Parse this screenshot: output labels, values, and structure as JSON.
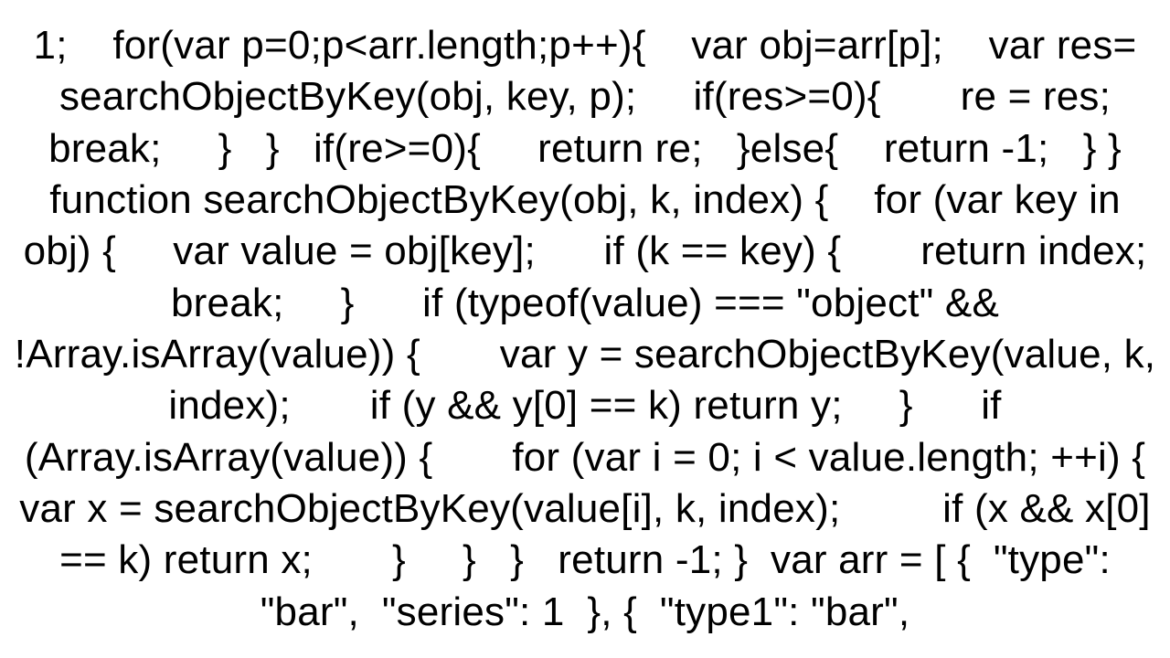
{
  "code_text": "1;    for(var p=0;p<arr.length;p++){    var obj=arr[p];    var res= searchObjectByKey(obj, key, p);     if(res>=0){       re = res;       break;     }   }   if(re>=0){     return re;   }else{    return -1;   } }  function searchObjectByKey(obj, k, index) {    for (var key in obj) {     var value = obj[key];      if (k == key) {       return index;       break;     }      if (typeof(value) === \"object\" && !Array.isArray(value)) {       var y = searchObjectByKey(value, k, index);       if (y && y[0] == k) return y;     }      if (Array.isArray(value)) {       for (var i = 0; i < value.length; ++i) {         var x = searchObjectByKey(value[i], k, index);         if (x && x[0] == k) return x;       }     }   }   return -1; }  var arr = [ {  \"type\": \"bar\",  \"series\": 1  }, {  \"type1\": \"bar\","
}
